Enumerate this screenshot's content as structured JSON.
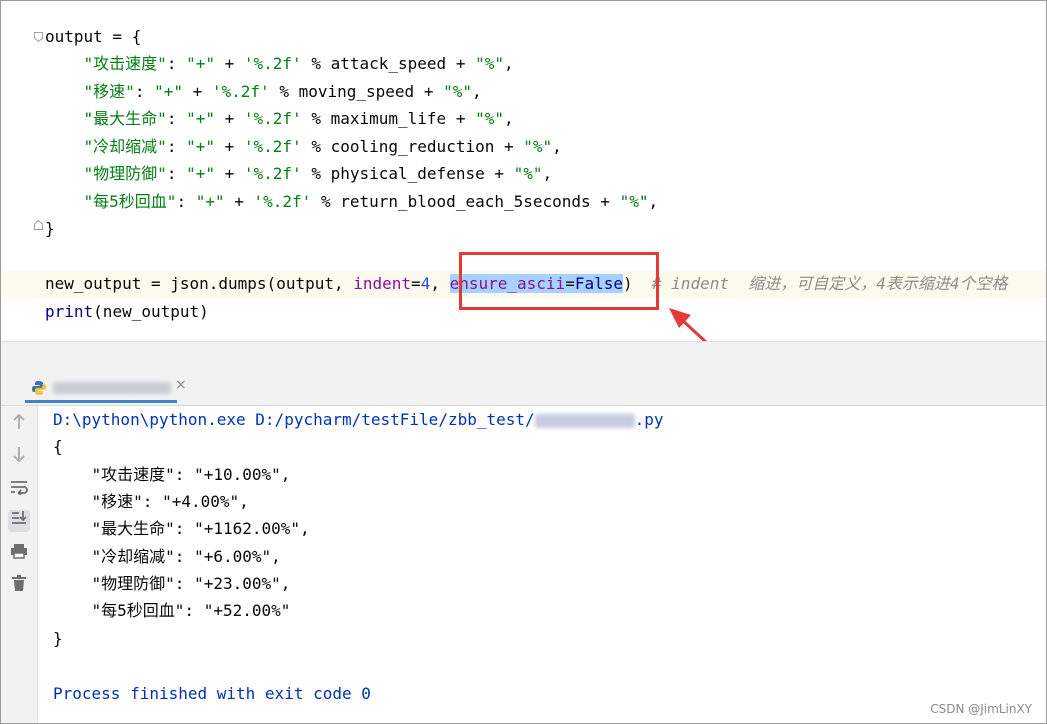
{
  "editor": {
    "line1": "output = {",
    "entries": [
      {
        "key": "\"攻击速度\"",
        "var": "attack_speed"
      },
      {
        "key": "\"移速\"",
        "var": "moving_speed"
      },
      {
        "key": "\"最大生命\"",
        "var": "maximum_life"
      },
      {
        "key": "\"冷却缩减\"",
        "var": "cooling_reduction"
      },
      {
        "key": "\"物理防御\"",
        "var": "physical_defense"
      },
      {
        "key": "\"每5秒回血\"",
        "var": "return_blood_each_5seconds"
      }
    ],
    "plus_str": "\"+\"",
    "fmt": "'%.2f'",
    "pct": "\"%\"",
    "closing": "}",
    "dumps_prefix": "new_output = json.dumps(output, ",
    "indent_kw": "indent",
    "indent_eq": "=",
    "indent_val": "4",
    "comma": ", ",
    "ensure_kw": "ensure_ascii",
    "ensure_eq": "=",
    "ensure_val": "False",
    "close_paren": ")",
    "comment": "# indent  缩进，可自定义，4表示缩进4个空格",
    "print_fn": "print",
    "print_args": "(new_output)"
  },
  "run_panel": {
    "tab_close": "×",
    "command_prefix": "D:\\python\\python.exe D:/pycharm/testFile/zbb_test/",
    "command_suffix": ".py",
    "output_lines": [
      "{",
      "    \"攻击速度\": \"+10.00%\",",
      "    \"移速\": \"+4.00%\",",
      "    \"最大生命\": \"+1162.00%\",",
      "    \"冷却缩减\": \"+6.00%\",",
      "    \"物理防御\": \"+23.00%\",",
      "    \"每5秒回血\": \"+52.00%\"",
      "}"
    ],
    "exit_message": "Process finished with exit code 0",
    "tools": [
      "arrow-up-icon",
      "arrow-down-icon",
      "soft-wrap-icon",
      "scroll-to-end-icon",
      "print-icon",
      "trash-icon"
    ]
  },
  "watermark": "CSDN @JimLinXY",
  "colors": {
    "string": "#067d17",
    "keyword_arg": "#871094",
    "number": "#1750eb",
    "comment": "#8c8c8c",
    "selection": "#a6d2ff",
    "highlight_box": "#e53935",
    "console_blue": "#0033b3"
  }
}
